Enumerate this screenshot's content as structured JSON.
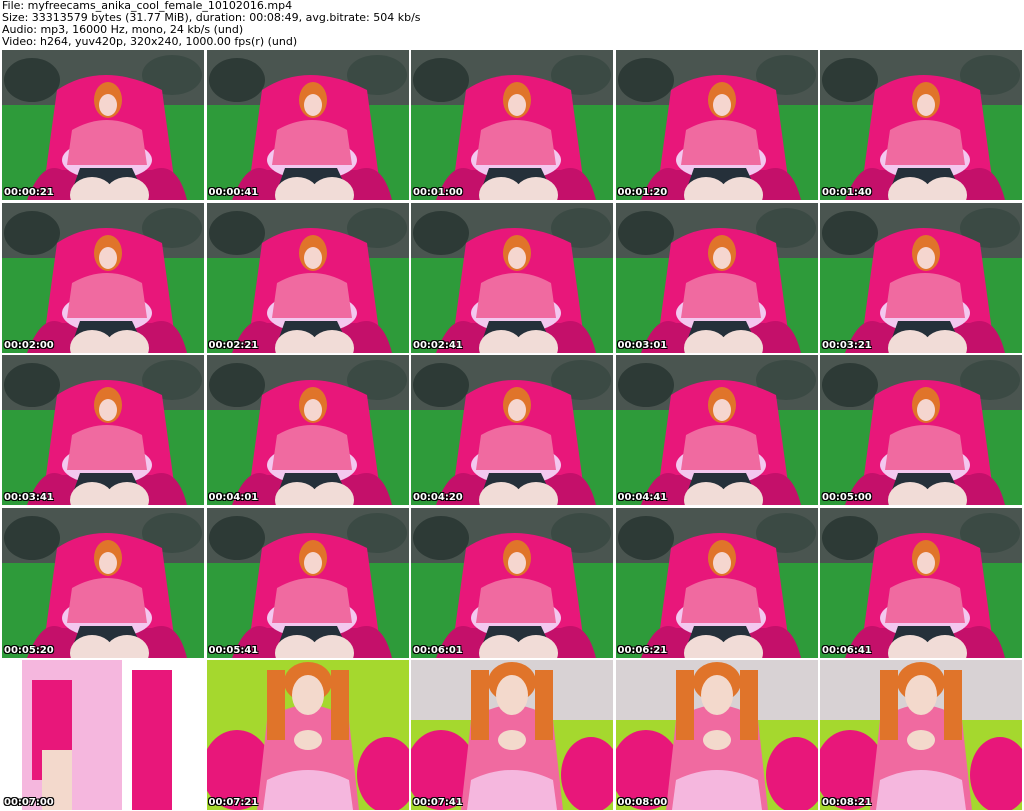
{
  "header": {
    "line1": "File: myfreecams_anika_cool_female_10102016.mp4",
    "line2": "Size: 33313579 bytes (31.77 MiB), duration: 00:08:49, avg.bitrate: 504 kb/s",
    "line3": "Audio: mp3, 16000 Hz, mono, 24 kb/s (und)",
    "line4": "Video: h264, yuv420p, 320x240, 1000.00 fps(r) (und)"
  },
  "thumbnails": [
    {
      "timestamp": "00:00:21"
    },
    {
      "timestamp": "00:00:41"
    },
    {
      "timestamp": "00:01:00"
    },
    {
      "timestamp": "00:01:20"
    },
    {
      "timestamp": "00:01:40"
    },
    {
      "timestamp": "00:02:00"
    },
    {
      "timestamp": "00:02:21"
    },
    {
      "timestamp": "00:02:41"
    },
    {
      "timestamp": "00:03:01"
    },
    {
      "timestamp": "00:03:21"
    },
    {
      "timestamp": "00:03:41"
    },
    {
      "timestamp": "00:04:01"
    },
    {
      "timestamp": "00:04:20"
    },
    {
      "timestamp": "00:04:41"
    },
    {
      "timestamp": "00:05:00"
    },
    {
      "timestamp": "00:05:20"
    },
    {
      "timestamp": "00:05:41"
    },
    {
      "timestamp": "00:06:01"
    },
    {
      "timestamp": "00:06:21"
    },
    {
      "timestamp": "00:06:41"
    },
    {
      "timestamp": "00:07:00"
    },
    {
      "timestamp": "00:07:21"
    },
    {
      "timestamp": "00:07:41"
    },
    {
      "timestamp": "00:08:00"
    },
    {
      "timestamp": "00:08:21"
    }
  ],
  "colors": {
    "scene_green": "#2e9b3a",
    "scene_pink": "#e8177a",
    "shirt_pink": "#f06aa0",
    "hair": "#e0742a",
    "wall_dark": "#4a5550",
    "closeup_green": "#a5d82e",
    "brick_white": "#d8d2d4"
  }
}
